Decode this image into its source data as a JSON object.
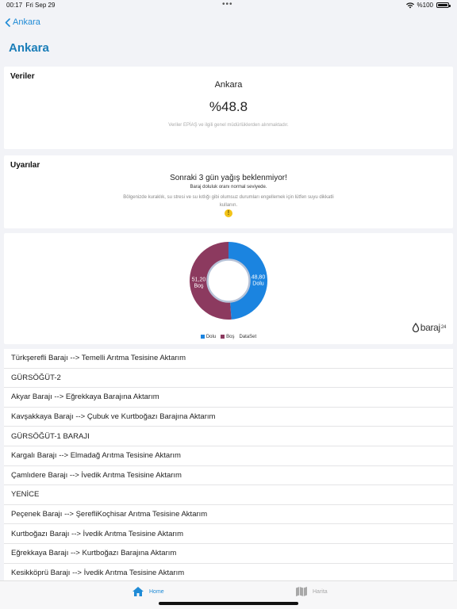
{
  "status_bar": {
    "time": "00:17",
    "date": "Fri Sep 29",
    "battery": "%100",
    "icons": [
      "wifi-icon",
      "battery-icon"
    ]
  },
  "nav": {
    "back_label": "Ankara",
    "title": "Ankara"
  },
  "data_card": {
    "heading": "Veriler",
    "city": "Ankara",
    "percent": "%48.8",
    "note": "Veriler EPİAŞ ve ilgili genel müdürlüklerden alınmaktadır."
  },
  "warnings_card": {
    "heading": "Uyarılar",
    "headline": "Sonraki 3 gün yağış beklenmiyor!",
    "subline": "Baraj doluluk oranı normal seviyede.",
    "description": "Bölgenizde kuraklık, su stresi ve su kıtlığı gibi olumsuz durumları engellemek için lütfen suyu dikkatli kullanın.",
    "icon": "warning-circle-icon"
  },
  "chart_data": {
    "type": "pie",
    "series": [
      {
        "name": "Dolu",
        "value": 48.8,
        "display": "48,80",
        "label": "Dolu",
        "color": "#1b84e0"
      },
      {
        "name": "Boş",
        "value": 51.2,
        "display": "51,20",
        "label": "Boş",
        "color": "#8c3a5f"
      }
    ],
    "legend": [
      "Dolu",
      "Boş",
      "DataSet"
    ],
    "legend_placement": "bottom",
    "ring_color": "#b7c3d8"
  },
  "brand": {
    "name": "baraj",
    "suffix": "24"
  },
  "transfers": [
    "Türkşerefli Barajı --> Temelli Arıtma Tesisine Aktarım",
    "GÜRSÖĞÜT-2",
    "Akyar Barajı --> Eğrekkaya Barajına Aktarım",
    "Kavşakkaya Barajı --> Çubuk ve Kurtboğazı Barajına Aktarım",
    "GÜRSÖĞÜT-1 BARAJI",
    "Kargalı Barajı --> Elmadağ Arıtma Tesisine Aktarım",
    "Çamlıdere Barajı --> İvedik Arıtma Tesisine Aktarım",
    "YENİCE",
    "Peçenek Barajı --> ŞerefliKoçhisar Arıtma Tesisine Aktarım",
    "Kurtboğazı Barajı --> İvedik Arıtma Tesisine Aktarım",
    "Eğrekkaya Barajı --> Kurtboğazı Barajına Aktarım",
    "Kesikköprü Barajı --> İvedik Arıtma Tesisine Aktarım"
  ],
  "tabs": [
    {
      "label": "Home",
      "icon": "house-icon",
      "active": true
    },
    {
      "label": "Harita",
      "icon": "map-icon",
      "active": false
    }
  ],
  "colors": {
    "accent": "#1f8bd6",
    "title": "#1a7db8",
    "background": "#f2f3f7"
  }
}
